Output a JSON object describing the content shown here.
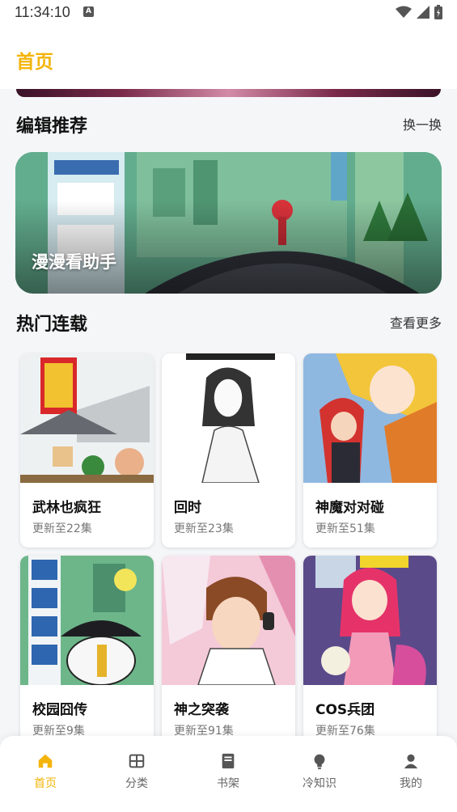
{
  "status_bar": {
    "time": "11:34:10"
  },
  "header": {
    "title": "首页"
  },
  "editor_pick": {
    "title": "编辑推荐",
    "action": "换一换",
    "card": {
      "title": "漫漫看助手"
    }
  },
  "hot_serial": {
    "title": "热门连载",
    "action": "查看更多",
    "comics": [
      {
        "name": "武林也疯狂",
        "update": "更新至22集"
      },
      {
        "name": "回时",
        "update": "更新至23集"
      },
      {
        "name": "神魔对对碰",
        "update": "更新至51集"
      },
      {
        "name": "校园囧传",
        "update": "更新至9集"
      },
      {
        "name": "神之突袭",
        "update": "更新至91集"
      },
      {
        "name": "COS兵团",
        "update": "更新至76集"
      }
    ]
  },
  "bottom_nav": {
    "items": [
      {
        "label": "首页",
        "icon": "home-icon",
        "active": true
      },
      {
        "label": "分类",
        "icon": "grid-icon",
        "active": false
      },
      {
        "label": "书架",
        "icon": "book-icon",
        "active": false
      },
      {
        "label": "冷知识",
        "icon": "bulb-icon",
        "active": false
      },
      {
        "label": "我的",
        "icon": "user-icon",
        "active": false
      }
    ]
  },
  "colors": {
    "accent": "#f3b40b",
    "background": "#f5f6f8"
  }
}
